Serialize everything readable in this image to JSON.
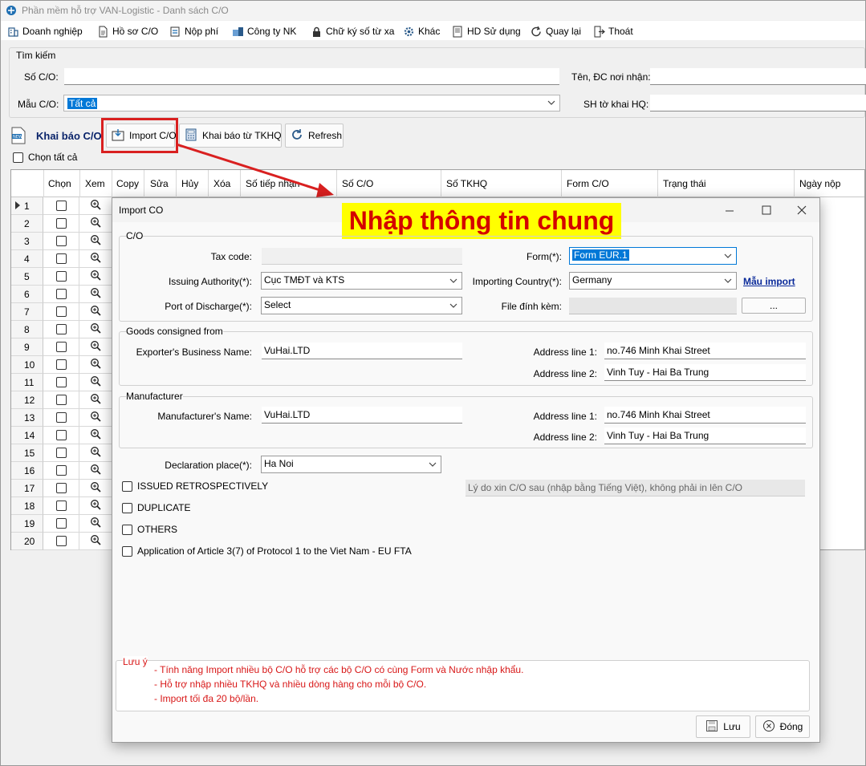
{
  "app": {
    "title": "Phần mềm hỗ trợ VAN-Logistic - Danh sách C/O"
  },
  "menu": [
    {
      "label": "Doanh nghiệp",
      "icon": "building-icon"
    },
    {
      "label": "Hồ sơ C/O",
      "icon": "document-icon"
    },
    {
      "label": "Nộp phí",
      "icon": "payment-icon"
    },
    {
      "label": "Công ty NK",
      "icon": "company-icon"
    },
    {
      "label": "Chữ ký số từ xa",
      "icon": "lock-icon"
    },
    {
      "label": "Khác",
      "icon": "gear-icon"
    },
    {
      "label": "HD Sử dụng",
      "icon": "help-icon"
    },
    {
      "label": "Quay lại",
      "icon": "back-icon"
    },
    {
      "label": "Thoát",
      "icon": "exit-icon"
    }
  ],
  "search": {
    "group_title": "Tìm kiếm",
    "so_co_label": "Số C/O:",
    "so_co_value": "",
    "ten_dc_label": "Tên, ĐC nơi nhận:",
    "ten_dc_value": "",
    "mau_co_label": "Mẫu C/O:",
    "mau_co_value": "Tất cả",
    "sh_to_khai_label": "SH tờ khai HQ:",
    "sh_to_khai_value": ""
  },
  "toolbar": {
    "khai_bao_co": "Khai báo C/O",
    "import_co": "Import C/O",
    "khai_bao_tkhq": "Khai báo từ TKHQ",
    "refresh": "Refresh",
    "chon_tat_ca": "Chọn tất cả"
  },
  "grid": {
    "columns": [
      "Chọn",
      "Xem",
      "Copy",
      "Sửa",
      "Hủy",
      "Xóa",
      "Số tiếp nhận",
      "Số C/O",
      "Số TKHQ",
      "Form C/O",
      "Trạng thái",
      "Ngày nộp"
    ],
    "rows": [
      "1",
      "2",
      "3",
      "4",
      "5",
      "6",
      "7",
      "8",
      "9",
      "10",
      "11",
      "12",
      "13",
      "14",
      "15",
      "16",
      "17",
      "18",
      "19",
      "20"
    ]
  },
  "annotation": {
    "banner_text": "Nhập thông tin chung",
    "highlight_color": "#d92020"
  },
  "dialog": {
    "title": "Import CO",
    "co_group": "C/O",
    "tax_code_label": "Tax code:",
    "tax_code_value": "",
    "form_label": "Form(*):",
    "form_value": "Form EUR.1",
    "issuing_label": "Issuing Authority(*):",
    "issuing_value": "Cục TMĐT và KTS",
    "importing_label": "Importing Country(*):",
    "importing_value": "Germany",
    "mau_import": "Mẫu import",
    "port_label": "Port of Discharge(*):",
    "port_value": "Select",
    "file_label": "File đính kèm:",
    "file_value": "",
    "browse": "...",
    "goods_group": "Goods consigned from",
    "exporter_label": "Exporter's Business Name:",
    "exporter_value": "VuHai.LTD",
    "addr1_label": "Address line 1:",
    "addr1_value": "no.746 Minh Khai Street",
    "addr2_label": "Address line 2:",
    "addr2_value": "Vinh Tuy - Hai Ba Trung",
    "manufacturer_group": "Manufacturer",
    "manufacturer_label": "Manufacturer's Name:",
    "manufacturer_value": "VuHai.LTD",
    "m_addr1_label": "Address line 1:",
    "m_addr1_value": "no.746 Minh Khai Street",
    "m_addr2_label": "Address line 2:",
    "m_addr2_value": "Vinh Tuy - Hai Ba Trung",
    "declaration_label": "Declaration place(*):",
    "declaration_value": "Ha Noi",
    "issued_retro": "ISSUED RETROSPECTIVELY",
    "reason_placeholder": "Lý do xin C/O sau (nhập bằng Tiếng Việt), không phải in lên C/O",
    "duplicate": "DUPLICATE",
    "others": "OTHERS",
    "article": "Application of Article 3(7) of Protocol 1 to the Viet Nam - EU FTA",
    "luu_y_label": "Lưu ý",
    "notes": [
      "- Tính năng Import nhiều bộ C/O hỗ trợ các bộ C/O có cùng Form và Nước nhập khẩu.",
      "- Hỗ trợ nhập nhiều TKHQ và nhiều dòng hàng cho mỗi bộ C/O.",
      "- Import tối đa 20 bộ/lần."
    ],
    "save": "Lưu",
    "close": "Đóng"
  }
}
